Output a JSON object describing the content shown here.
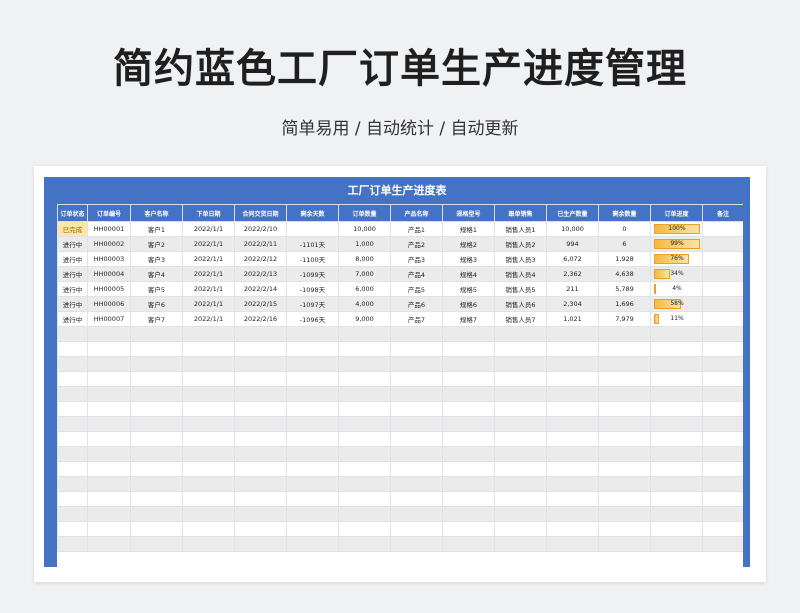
{
  "header": {
    "title": "简约蓝色工厂订单生产进度管理",
    "subtitle": "简单易用 / 自动统计 / 自动更新"
  },
  "sheet": {
    "title": "工厂订单生产进度表",
    "columns": [
      "订单状态",
      "订单编号",
      "客户名称",
      "下单日期",
      "合同交货日期",
      "剩余天数",
      "订单数量",
      "产品名称",
      "规格型号",
      "跟单销售",
      "已生产数量",
      "剩余数量",
      "订单进度",
      "备注"
    ],
    "rows": [
      {
        "status": "已完成",
        "order_no": "HH00001",
        "customer": "客户1",
        "order_date": "2022/1/1",
        "delivery_date": "2022/2/10",
        "remaining_days": "",
        "quantity": "10,000",
        "product": "产品1",
        "spec": "规格1",
        "sales": "销售人员1",
        "produced": "10,000",
        "remaining_qty": "0",
        "progress": 1.0,
        "progress_label": "100%",
        "note": ""
      },
      {
        "status": "进行中",
        "order_no": "HH00002",
        "customer": "客户2",
        "order_date": "2022/1/1",
        "delivery_date": "2022/2/11",
        "remaining_days": "-1101天",
        "quantity": "1,000",
        "product": "产品2",
        "spec": "规格2",
        "sales": "销售人员2",
        "produced": "994",
        "remaining_qty": "6",
        "progress": 0.99,
        "progress_label": "99%",
        "note": ""
      },
      {
        "status": "进行中",
        "order_no": "HH00003",
        "customer": "客户3",
        "order_date": "2022/1/1",
        "delivery_date": "2022/2/12",
        "remaining_days": "-1100天",
        "quantity": "8,000",
        "product": "产品3",
        "spec": "规格3",
        "sales": "销售人员3",
        "produced": "6,072",
        "remaining_qty": "1,928",
        "progress": 0.76,
        "progress_label": "76%",
        "note": ""
      },
      {
        "status": "进行中",
        "order_no": "HH00004",
        "customer": "客户4",
        "order_date": "2022/1/1",
        "delivery_date": "2022/2/13",
        "remaining_days": "-1099天",
        "quantity": "7,000",
        "product": "产品4",
        "spec": "规格4",
        "sales": "销售人员4",
        "produced": "2,362",
        "remaining_qty": "4,638",
        "progress": 0.34,
        "progress_label": "34%",
        "note": ""
      },
      {
        "status": "进行中",
        "order_no": "HH00005",
        "customer": "客户5",
        "order_date": "2022/1/1",
        "delivery_date": "2022/2/14",
        "remaining_days": "-1098天",
        "quantity": "6,000",
        "product": "产品5",
        "spec": "规格5",
        "sales": "销售人员5",
        "produced": "211",
        "remaining_qty": "5,789",
        "progress": 0.04,
        "progress_label": "4%",
        "note": ""
      },
      {
        "status": "进行中",
        "order_no": "HH00006",
        "customer": "客户6",
        "order_date": "2022/1/1",
        "delivery_date": "2022/2/15",
        "remaining_days": "-1097天",
        "quantity": "4,000",
        "product": "产品6",
        "spec": "规格6",
        "sales": "销售人员6",
        "produced": "2,304",
        "remaining_qty": "1,696",
        "progress": 0.58,
        "progress_label": "58%",
        "note": ""
      },
      {
        "status": "进行中",
        "order_no": "HH00007",
        "customer": "客户7",
        "order_date": "2022/1/1",
        "delivery_date": "2022/2/16",
        "remaining_days": "-1096天",
        "quantity": "9,000",
        "product": "产品7",
        "spec": "规格7",
        "sales": "销售人员7",
        "produced": "1,021",
        "remaining_qty": "7,979",
        "progress": 0.11,
        "progress_label": "11%",
        "note": ""
      }
    ],
    "empty_rows": 15
  },
  "colors": {
    "header_blue": "#4472c4",
    "done_highlight": "#fde6a8",
    "progress_bar": "#f4b942"
  }
}
